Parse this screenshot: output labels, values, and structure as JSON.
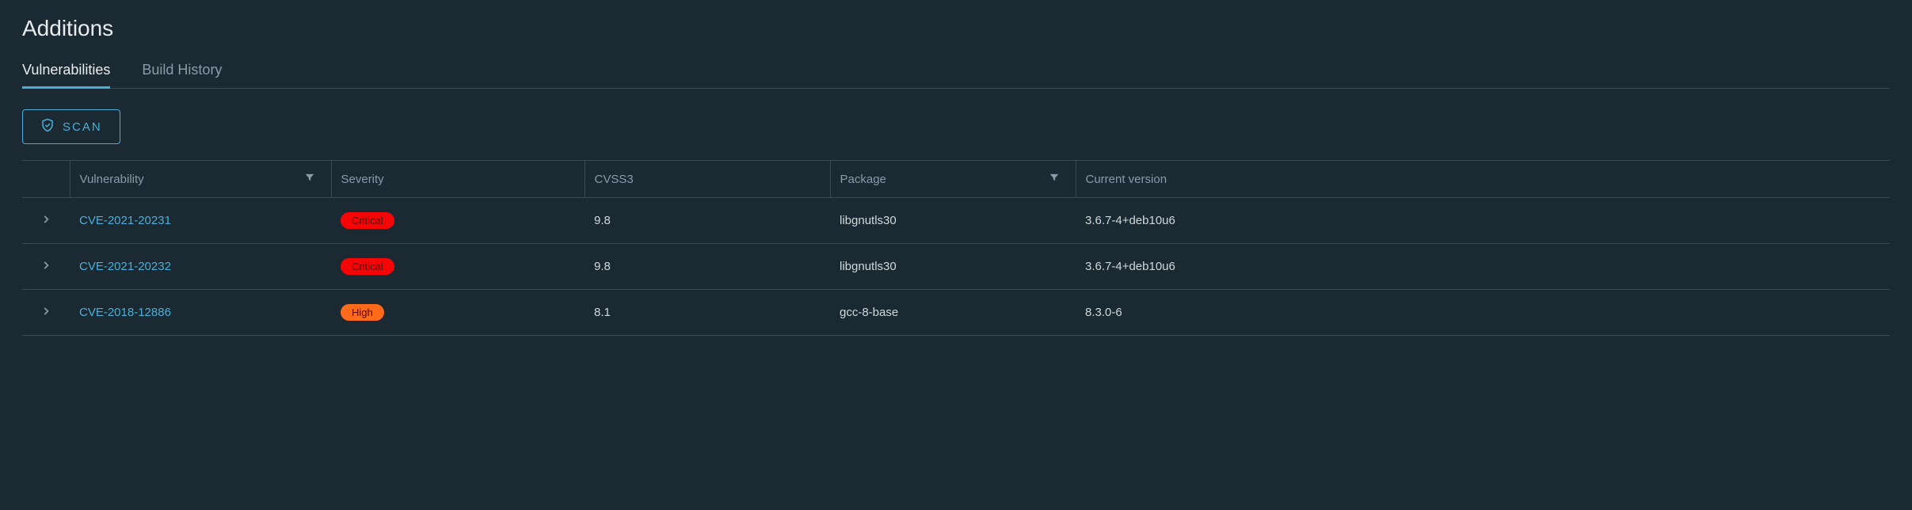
{
  "page_title": "Additions",
  "tabs": [
    {
      "label": "Vulnerabilities",
      "active": true
    },
    {
      "label": "Build History",
      "active": false
    }
  ],
  "actions": {
    "scan_label": "SCAN"
  },
  "columns": {
    "vulnerability": "Vulnerability",
    "severity": "Severity",
    "cvss3": "CVSS3",
    "package": "Package",
    "current_version": "Current version"
  },
  "severity_colors": {
    "Critical": "#f50505",
    "High": "#ff6b1a"
  },
  "rows": [
    {
      "vulnerability": "CVE-2021-20231",
      "severity": "Critical",
      "cvss3": "9.8",
      "package": "libgnutls30",
      "current_version": "3.6.7-4+deb10u6"
    },
    {
      "vulnerability": "CVE-2021-20232",
      "severity": "Critical",
      "cvss3": "9.8",
      "package": "libgnutls30",
      "current_version": "3.6.7-4+deb10u6"
    },
    {
      "vulnerability": "CVE-2018-12886",
      "severity": "High",
      "cvss3": "8.1",
      "package": "gcc-8-base",
      "current_version": "8.3.0-6"
    }
  ]
}
